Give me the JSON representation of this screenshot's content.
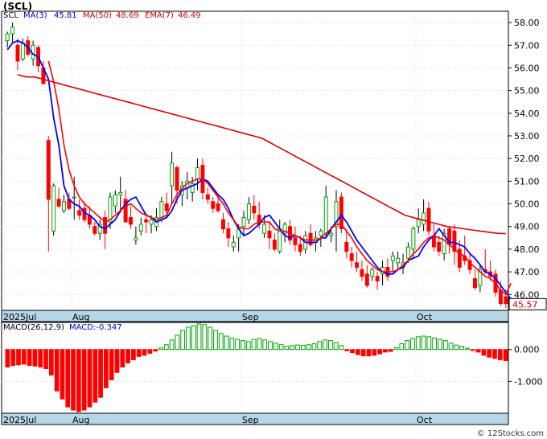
{
  "header": {
    "title": "(SCL)",
    "ticker": "SCL",
    "ma3_label": "MA(3)",
    "ma3_value": "45.81",
    "ma50_label": "MA(50)",
    "ma50_value": "48.69",
    "ema_label": "EMA(7)",
    "ema_value": "46.49"
  },
  "price_tag": "45.57",
  "macd_header": {
    "label": "MACD(26,12,9)",
    "value_label": "MACD:-0.347"
  },
  "footer": "© 12Stocks.com",
  "colors": {
    "up": "#00a000",
    "down": "#ff0000",
    "ma3": "#0000ff",
    "ema": "#ff0000",
    "ma50": "#dd0000",
    "axis_band": "#b4d7e8"
  },
  "chart_data": [
    {
      "type": "candlestick",
      "ylim": [
        45.3,
        58.5
      ],
      "y_ticks": [
        "58.00",
        "57.00",
        "56.00",
        "55.00",
        "54.00",
        "53.00",
        "52.00",
        "51.00",
        "50.00",
        "49.00",
        "48.00",
        "47.00",
        "46.00"
      ],
      "x_labels": [
        "2025Jul",
        "Aug",
        "Sep",
        "Oct"
      ],
      "x_label_index": [
        0,
        13,
        46,
        80
      ],
      "candles": [
        [
          57.2,
          57.6,
          56.9,
          57.5
        ],
        [
          57.5,
          58.0,
          57.1,
          57.8
        ],
        [
          57.0,
          57.3,
          55.9,
          56.3
        ],
        [
          56.4,
          57.3,
          56.3,
          57.1
        ],
        [
          57.2,
          57.4,
          56.5,
          56.6
        ],
        [
          56.4,
          57.2,
          56.1,
          57.0
        ],
        [
          56.9,
          57.0,
          55.8,
          56.1
        ],
        [
          56.0,
          56.3,
          55.4,
          55.3
        ],
        [
          52.8,
          53.0,
          47.9,
          50.2
        ],
        [
          48.8,
          50.9,
          48.6,
          50.8
        ],
        [
          50.2,
          50.7,
          49.8,
          49.9
        ],
        [
          49.7,
          50.4,
          49.6,
          50.1
        ],
        [
          50.2,
          50.5,
          49.7,
          49.8
        ],
        [
          50.3,
          51.2,
          49.3,
          50.3
        ],
        [
          49.7,
          50.2,
          49.3,
          49.5
        ],
        [
          49.8,
          50.1,
          49.2,
          49.3
        ],
        [
          49.5,
          49.9,
          48.9,
          49.1
        ],
        [
          49.0,
          49.2,
          48.6,
          48.7
        ],
        [
          48.7,
          49.3,
          48.4,
          49.1
        ],
        [
          49.4,
          49.7,
          48.0,
          48.7
        ],
        [
          49.2,
          50.5,
          48.9,
          50.3
        ],
        [
          49.9,
          50.6,
          49.6,
          50.4
        ],
        [
          50.4,
          51.2,
          49.6,
          50.5
        ],
        [
          50.2,
          50.6,
          49.2,
          49.2
        ],
        [
          49.4,
          49.9,
          48.9,
          49.1
        ],
        [
          48.4,
          49.0,
          48.2,
          48.5
        ],
        [
          48.8,
          49.4,
          48.6,
          49.1
        ],
        [
          49.3,
          49.6,
          48.7,
          49.2
        ],
        [
          49.1,
          49.5,
          48.7,
          49.3
        ],
        [
          49.0,
          49.8,
          48.8,
          49.4
        ],
        [
          49.3,
          50.3,
          49.2,
          50.1
        ],
        [
          50.0,
          50.5,
          49.4,
          49.7
        ],
        [
          50.8,
          52.3,
          50.0,
          51.8
        ],
        [
          51.6,
          51.7,
          50.0,
          50.6
        ],
        [
          50.4,
          51.0,
          49.9,
          50.8
        ],
        [
          50.7,
          51.4,
          50.2,
          51.0
        ],
        [
          50.5,
          51.2,
          50.1,
          50.9
        ],
        [
          51.1,
          52.0,
          50.6,
          51.6
        ],
        [
          51.7,
          52.0,
          50.2,
          50.5
        ],
        [
          50.4,
          50.7,
          50.0,
          50.2
        ],
        [
          50.1,
          50.3,
          49.6,
          49.8
        ],
        [
          50.0,
          50.4,
          49.6,
          49.7
        ],
        [
          49.3,
          49.6,
          48.7,
          48.9
        ],
        [
          48.9,
          49.2,
          48.1,
          48.5
        ],
        [
          48.1,
          48.6,
          47.9,
          48.3
        ],
        [
          48.5,
          49.1,
          47.9,
          48.9
        ],
        [
          49.0,
          49.7,
          48.6,
          49.4
        ],
        [
          49.3,
          50.3,
          49.1,
          50.0
        ],
        [
          49.9,
          50.4,
          49.3,
          49.6
        ],
        [
          49.5,
          50.1,
          48.9,
          49.1
        ],
        [
          48.7,
          49.5,
          48.5,
          49.1
        ],
        [
          48.8,
          49.2,
          48.0,
          48.5
        ],
        [
          48.4,
          48.7,
          47.9,
          48.0
        ],
        [
          47.9,
          49.3,
          47.8,
          48.9
        ],
        [
          48.7,
          49.2,
          48.3,
          49.1
        ],
        [
          49.0,
          49.3,
          48.2,
          48.4
        ],
        [
          48.5,
          49.0,
          47.9,
          48.2
        ],
        [
          48.2,
          48.6,
          47.7,
          47.9
        ],
        [
          48.0,
          48.8,
          47.8,
          48.6
        ],
        [
          48.7,
          49.1,
          48.1,
          48.2
        ],
        [
          48.3,
          48.8,
          47.9,
          48.5
        ],
        [
          48.6,
          48.9,
          48.1,
          48.8
        ],
        [
          48.7,
          50.8,
          48.5,
          50.3
        ],
        [
          48.6,
          49.0,
          48.3,
          48.7
        ],
        [
          49.0,
          50.6,
          47.9,
          50.1
        ],
        [
          50.3,
          50.5,
          48.7,
          48.9
        ],
        [
          48.3,
          48.9,
          47.6,
          47.9
        ],
        [
          47.8,
          48.1,
          47.2,
          47.5
        ],
        [
          47.4,
          47.9,
          47.0,
          47.2
        ],
        [
          47.1,
          47.5,
          46.6,
          46.8
        ],
        [
          46.9,
          47.3,
          46.3,
          46.4
        ],
        [
          46.8,
          47.2,
          46.6,
          47.1
        ],
        [
          46.8,
          47.0,
          46.2,
          46.6
        ],
        [
          46.9,
          47.5,
          46.4,
          47.2
        ],
        [
          47.2,
          47.6,
          46.6,
          46.8
        ],
        [
          47.5,
          47.9,
          47.0,
          47.7
        ],
        [
          47.4,
          47.9,
          47.1,
          47.6
        ],
        [
          47.2,
          47.8,
          46.9,
          47.4
        ],
        [
          47.6,
          48.3,
          47.4,
          48.1
        ],
        [
          48.0,
          49.0,
          47.6,
          48.9
        ],
        [
          49.0,
          49.8,
          48.7,
          49.3
        ],
        [
          49.1,
          50.2,
          48.8,
          49.6
        ],
        [
          49.8,
          50.1,
          48.6,
          48.8
        ],
        [
          48.6,
          49.1,
          47.9,
          48.1
        ],
        [
          48.3,
          48.6,
          47.7,
          47.9
        ],
        [
          47.8,
          48.9,
          47.5,
          48.7
        ],
        [
          48.9,
          49.0,
          47.8,
          48.2
        ],
        [
          48.8,
          49.1,
          47.3,
          47.9
        ],
        [
          48.0,
          48.4,
          47.0,
          47.2
        ],
        [
          47.7,
          48.6,
          47.3,
          47.5
        ],
        [
          47.5,
          47.8,
          46.9,
          47.1
        ],
        [
          46.7,
          47.1,
          46.2,
          46.3
        ],
        [
          46.4,
          47.3,
          46.1,
          47.1
        ],
        [
          47.1,
          48.0,
          46.9,
          47.0
        ],
        [
          47.0,
          47.5,
          46.6,
          46.8
        ],
        [
          46.9,
          47.1,
          45.9,
          46.1
        ],
        [
          46.2,
          46.6,
          45.5,
          45.6
        ],
        [
          45.9,
          46.2,
          45.4,
          45.6
        ]
      ],
      "series": [
        {
          "name": "MA(3)",
          "values": [
            56.8,
            57.1,
            57.2,
            57.1,
            56.9,
            56.6,
            56.5,
            56.0,
            55.5,
            53.8,
            52.6,
            50.8,
            50.2,
            50.0,
            49.9,
            49.6,
            49.5,
            49.3,
            49.0,
            48.9,
            49.1,
            49.3,
            49.7,
            50.0,
            50.2,
            50.3,
            49.9,
            49.5,
            49.4,
            49.2,
            49.3,
            49.4,
            49.7,
            50.2,
            50.6,
            50.7,
            50.8,
            50.9,
            51.1,
            51.0,
            50.7,
            50.4,
            50.2,
            49.8,
            49.3,
            48.9,
            48.6,
            48.7,
            48.9,
            49.1,
            49.4,
            49.5,
            49.2,
            48.9,
            48.6,
            48.5,
            48.6,
            48.5,
            48.3,
            48.3,
            48.3,
            48.5,
            48.5,
            48.9,
            49.2,
            49.5,
            49.2,
            48.8,
            48.4,
            48.1,
            47.8,
            47.5,
            47.2,
            47.0,
            46.9,
            46.9,
            47.1,
            47.2,
            47.5,
            47.6,
            47.7,
            48.1,
            48.4,
            48.6,
            48.9,
            48.6,
            48.3,
            48.3,
            48.2,
            48.1,
            47.8,
            47.6,
            47.3,
            47.0,
            46.9,
            46.7,
            46.4,
            46.1,
            45.8
          ]
        },
        {
          "name": "EMA(7)",
          "values": [
            null,
            null,
            null,
            null,
            null,
            null,
            null,
            null,
            56.3,
            55.4,
            54.2,
            52.6,
            51.5,
            50.8,
            50.3,
            50.0,
            49.8,
            49.6,
            49.4,
            49.2,
            49.3,
            49.5,
            49.7,
            49.9,
            50.0,
            49.8,
            49.6,
            49.5,
            49.4,
            49.3,
            49.4,
            49.5,
            50.0,
            50.4,
            50.7,
            50.9,
            51.0,
            51.1,
            51.1,
            50.9,
            50.6,
            50.3,
            50.0,
            49.6,
            49.3,
            49.0,
            48.9,
            48.9,
            49.1,
            49.2,
            49.2,
            49.2,
            48.9,
            48.8,
            48.8,
            48.7,
            48.6,
            48.5,
            48.4,
            48.4,
            48.4,
            48.5,
            48.7,
            48.9,
            49.1,
            49.1,
            48.8,
            48.5,
            48.1,
            47.8,
            47.5,
            47.3,
            47.1,
            47.0,
            47.0,
            47.0,
            47.1,
            47.3,
            47.5,
            47.8,
            48.0,
            48.3,
            48.5,
            48.6,
            48.5,
            48.4,
            48.2,
            48.0,
            47.8,
            47.7,
            47.4,
            47.2,
            47.0,
            46.8,
            46.7,
            46.5,
            46.2,
            46.0,
            46.5
          ]
        },
        {
          "name": "MA(50)",
          "values": [
            null,
            null,
            null,
            null,
            null,
            null,
            null,
            null,
            null,
            null,
            null,
            null,
            null,
            55.7,
            55.6,
            55.6,
            55.5,
            55.4,
            55.3,
            55.2,
            55.1,
            55.0,
            54.9,
            54.8,
            54.7,
            54.6,
            54.5,
            54.4,
            54.3,
            54.2,
            54.1,
            54.0,
            53.9,
            53.8,
            53.7,
            53.6,
            53.5,
            53.4,
            53.3,
            53.2,
            53.1,
            53.0,
            52.9,
            52.7,
            52.5,
            52.3,
            52.1,
            51.9,
            51.7,
            51.5,
            51.3,
            51.1,
            50.9,
            50.7,
            50.5,
            50.3,
            50.1,
            49.9,
            49.7,
            49.5,
            49.4,
            49.3,
            49.2,
            49.1,
            49.0,
            48.95,
            48.9,
            48.85,
            48.8,
            48.75,
            48.7,
            48.69
          ]
        }
      ]
    },
    {
      "type": "bar",
      "title": "MACD(26,12,9)",
      "ylim": [
        -2.0,
        0.85
      ],
      "y_ticks": [
        "0.000",
        "-1.000"
      ],
      "x_labels": [
        "2025Jul",
        "Aug",
        "Sep",
        "Oct"
      ],
      "values": [
        -0.55,
        -0.5,
        -0.48,
        -0.46,
        -0.5,
        -0.52,
        -0.55,
        -0.6,
        -0.8,
        -1.3,
        -1.55,
        -1.8,
        -1.9,
        -1.95,
        -1.9,
        -1.8,
        -1.65,
        -1.5,
        -1.2,
        -0.95,
        -0.72,
        -0.55,
        -0.42,
        -0.32,
        -0.22,
        -0.18,
        -0.12,
        -0.05,
        0.05,
        0.15,
        0.3,
        0.45,
        0.6,
        0.7,
        0.75,
        0.8,
        0.78,
        0.7,
        0.6,
        0.5,
        0.42,
        0.36,
        0.32,
        0.28,
        0.25,
        0.32,
        0.35,
        0.3,
        0.25,
        0.2,
        0.15,
        0.1,
        0.12,
        0.14,
        0.13,
        0.15,
        0.18,
        0.25,
        0.3,
        0.28,
        0.22,
        0.12,
        -0.04,
        -0.1,
        -0.16,
        -0.2,
        -0.2,
        -0.18,
        -0.14,
        -0.08,
        -0.06,
        0.06,
        0.18,
        0.28,
        0.35,
        0.4,
        0.42,
        0.4,
        0.36,
        0.32,
        0.28,
        0.2,
        0.14,
        0.1,
        0.04,
        -0.03,
        -0.08,
        -0.18,
        -0.24,
        -0.28,
        -0.32,
        -0.347
      ]
    }
  ]
}
